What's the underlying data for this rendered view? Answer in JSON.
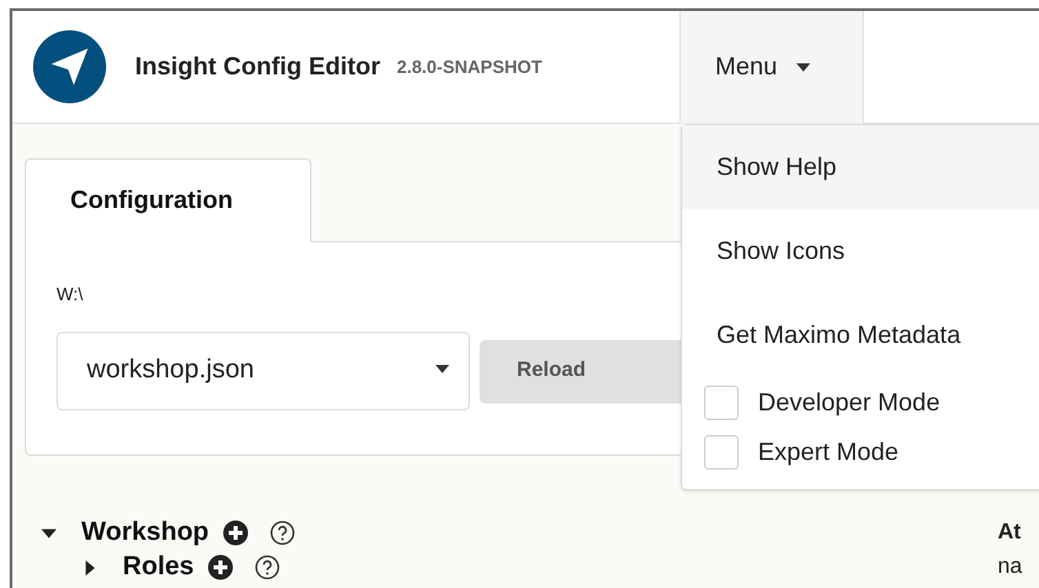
{
  "app": {
    "title": "Insight Config Editor",
    "version": "2.8.0-SNAPSHOT"
  },
  "menu": {
    "label": "Menu",
    "expanded": true,
    "items": [
      {
        "kind": "action",
        "label": "Show Help",
        "selected": true
      },
      {
        "kind": "action",
        "label": "Show Icons",
        "selected": false
      },
      {
        "kind": "action",
        "label": "Get Maximo Metadata",
        "selected": false
      },
      {
        "kind": "checkbox",
        "label": "Developer Mode",
        "selected": false,
        "checked": false
      },
      {
        "kind": "checkbox",
        "label": "Expert Mode",
        "selected": false,
        "checked": false
      }
    ]
  },
  "tabs": [
    {
      "label": "Configuration",
      "selected": true
    }
  ],
  "path": "W:\\",
  "file_select": {
    "value": "workshop.json"
  },
  "buttons": [
    "Reload"
  ],
  "tree": [
    {
      "label": "Workshop",
      "expanded": true,
      "children": [
        {
          "label": "Roles",
          "expanded": false
        }
      ]
    }
  ],
  "help_panel": {
    "heading": "At",
    "text": "na"
  }
}
